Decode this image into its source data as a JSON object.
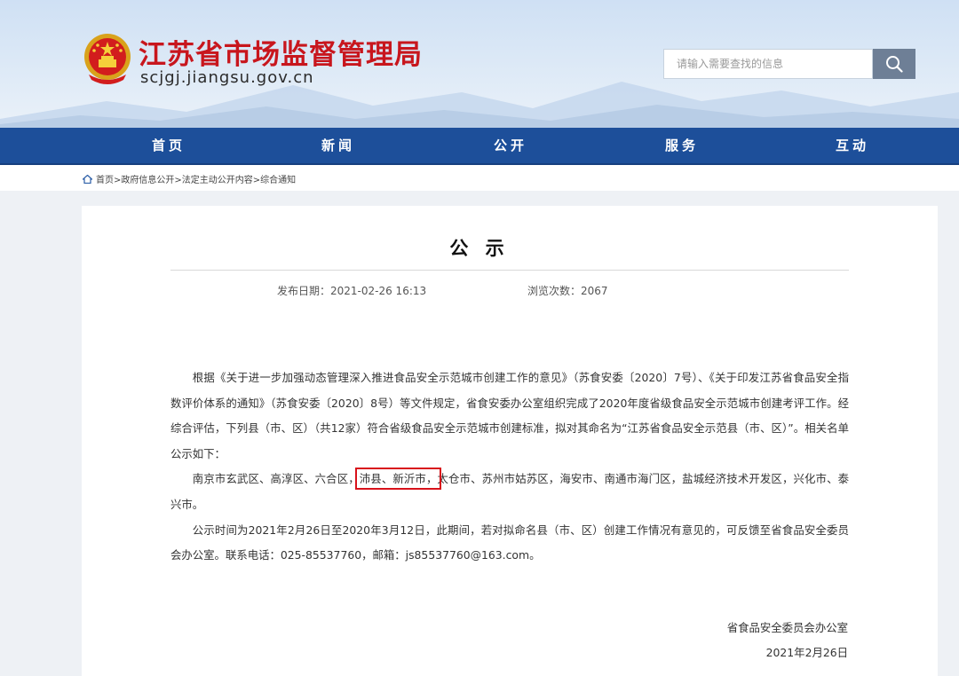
{
  "header": {
    "site_title": "江苏省市场监督管理局",
    "site_domain": "scjgj.jiangsu.gov.cn",
    "search_placeholder": "请输入需要查找的信息",
    "colors": {
      "title_red": "#c8161d",
      "nav_blue": "#1d4f9a",
      "search_btn": "#6e7f96",
      "highlight_red": "#d8121b"
    },
    "icons": {
      "emblem": "national-emblem-icon",
      "search": "search-icon"
    }
  },
  "nav": {
    "items": [
      "首页",
      "新闻",
      "公开",
      "服务",
      "互动"
    ]
  },
  "breadcrumb": {
    "icon": "home-icon",
    "text": "首页>政府信息公开>法定主动公开内容>综合通知"
  },
  "article": {
    "title": "公 示",
    "publish_date": "发布日期：2021-02-26 16:13",
    "view_count": "浏览次数：2067",
    "para1": "根据《关于进一步加强动态管理深入推进食品安全示范城市创建工作的意见》（苏食安委〔2020〕7号）、《关于印发江苏省食品安全指数评价体系的通知》（苏食安委〔2020〕8号）等文件规定，省食安委办公室组织完成了2020年度省级食品安全示范城市创建考评工作。经综合评估，下列县（市、区）（共12家）符合省级食品安全示范城市创建标准，拟对其命名为“江苏省食品安全示范县（市、区）”。相关名单公示如下：",
    "para2_before": "南京市玄武区、高淳区、六合区，",
    "para2_highlight": "沛县、新沂市，",
    "para2_after": "太仓市、苏州市姑苏区，海安市、南通市海门区，盐城经济技术开发区，兴化市、泰兴市。",
    "para3": "公示时间为2021年2月26日至2020年3月12日，此期间，若对拟命名县（市、区）创建工作情况有意见的，可反馈至省食品安全委员会办公室。联系电话：025-85537760，邮箱：js85537760@163.com。",
    "signature": "省食品安全委员会办公室",
    "sign_date": "2021年2月26日"
  }
}
